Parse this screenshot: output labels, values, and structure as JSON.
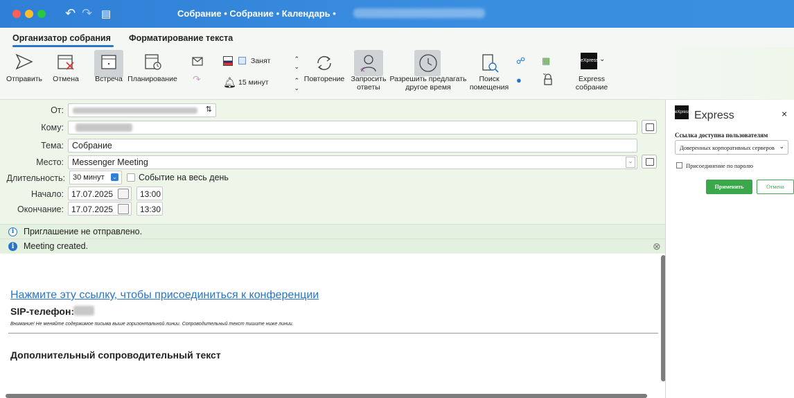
{
  "window": {
    "title": "Собрание • Собрание • Календарь •"
  },
  "tabs": [
    {
      "label": "Организатор собрания"
    },
    {
      "label": "Форматирование текста"
    }
  ],
  "ribbon": {
    "send": "Отправить",
    "cancel": "Отмена",
    "meeting": "Встреча",
    "planning": "Планирование",
    "status_value": "Занят",
    "reminder_value": "15 минут",
    "repeat": "Повторение",
    "request_responses": "Запросить ответы",
    "allow_other_time": "Разрешить предлагать другое время",
    "find_room": "Поиск помещения",
    "express_meeting": "Express собрание"
  },
  "form": {
    "from_label": "От:",
    "to_label": "Кому:",
    "subject_label": "Тема:",
    "subject_value": "Собрание",
    "location_label": "Место:",
    "location_value": "Messenger Meeting",
    "duration_label": "Длительность:",
    "duration_value": "30 минут",
    "all_day_label": "Событие на весь день",
    "start_label": "Начало:",
    "start_date": "17.07.2025",
    "start_time": "13:00",
    "end_label": "Окончание:",
    "end_date": "17.07.2025",
    "end_time": "13:30"
  },
  "info": {
    "not_sent": "Приглашение не отправлено.",
    "created": "Meeting created."
  },
  "message": {
    "join_link": "Нажмите эту ссылку, чтобы присоединиться к конференции",
    "sip_label": "SIP-телефон:",
    "warning": "Внимание! Не меняйте содержимое письма выше горизонтальной линии. Сопроводительный текст пишите ниже линии.",
    "extra_text": "Дополнительный сопроводительный текст"
  },
  "side_panel": {
    "title": "Express",
    "close": "×",
    "access_label": "Ссылка доступна пользователям",
    "access_value": "Доверенных корпоративных серверов",
    "password_label": "Присоединение по паролю",
    "apply": "Применить",
    "cancel": "Отмена"
  },
  "colors": {
    "titlebar": "#2f7fd6",
    "accent": "#2775c8",
    "link": "#2775c8",
    "apply_green": "#3aa84a",
    "background": "#eef6ea"
  }
}
